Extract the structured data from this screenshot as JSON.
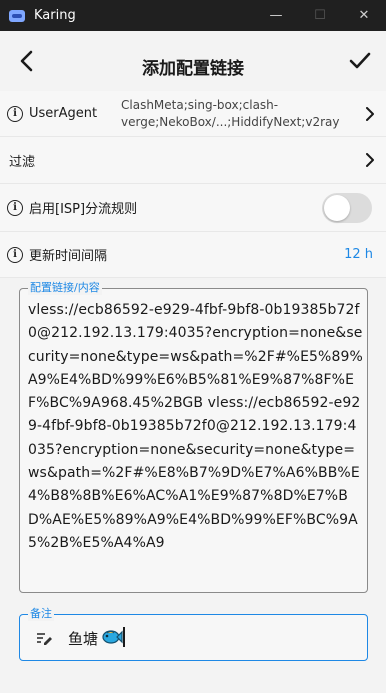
{
  "window": {
    "title": "Karing",
    "minimize": "—",
    "maximize": "☐",
    "close": "✕"
  },
  "header": {
    "title": "添加配置链接"
  },
  "settings": {
    "user_agent": {
      "label": "UserAgent",
      "value": "ClashMeta;sing-box;clash-verge;NekoBox/...;HiddifyNext;v2ray"
    },
    "filter": {
      "label": "过滤"
    },
    "isp_rules": {
      "label": "启用[ISP]分流规则",
      "enabled": false
    },
    "update_interval": {
      "label": "更新时间间隔",
      "value": "12 h"
    }
  },
  "content": {
    "label": "配置链接/内容",
    "value": "vless://ecb86592-e929-4fbf-9bf8-0b19385b72f0@212.192.13.179:4035?encryption=none&security=none&type=ws&path=%2F#%E5%89%A9%E4%BD%99%E6%B5%81%E9%87%8F%EF%BC%9A968.45%2BGB vless://ecb86592-e929-4fbf-9bf8-0b19385b72f0@212.192.13.179:4035?encryption=none&security=none&type=ws&path=%2F#%E8%B7%9D%E7%A6%BB%E4%B8%8B%E6%AC%A1%E9%87%8D%E7%BD%AE%E5%89%A9%E4%BD%99%EF%BC%9A5%2B%E5%A4%A9"
  },
  "note": {
    "label": "备注",
    "value": "鱼塘"
  },
  "colors": {
    "accent": "#1e88e5",
    "titlebar": "#202020",
    "background": "#f3f3f3"
  },
  "icons": [
    "app-logo-icon",
    "back-arrow-icon",
    "check-icon",
    "info-icon",
    "chevron-right-icon",
    "edit-note-icon",
    "fish-emoji-icon"
  ]
}
